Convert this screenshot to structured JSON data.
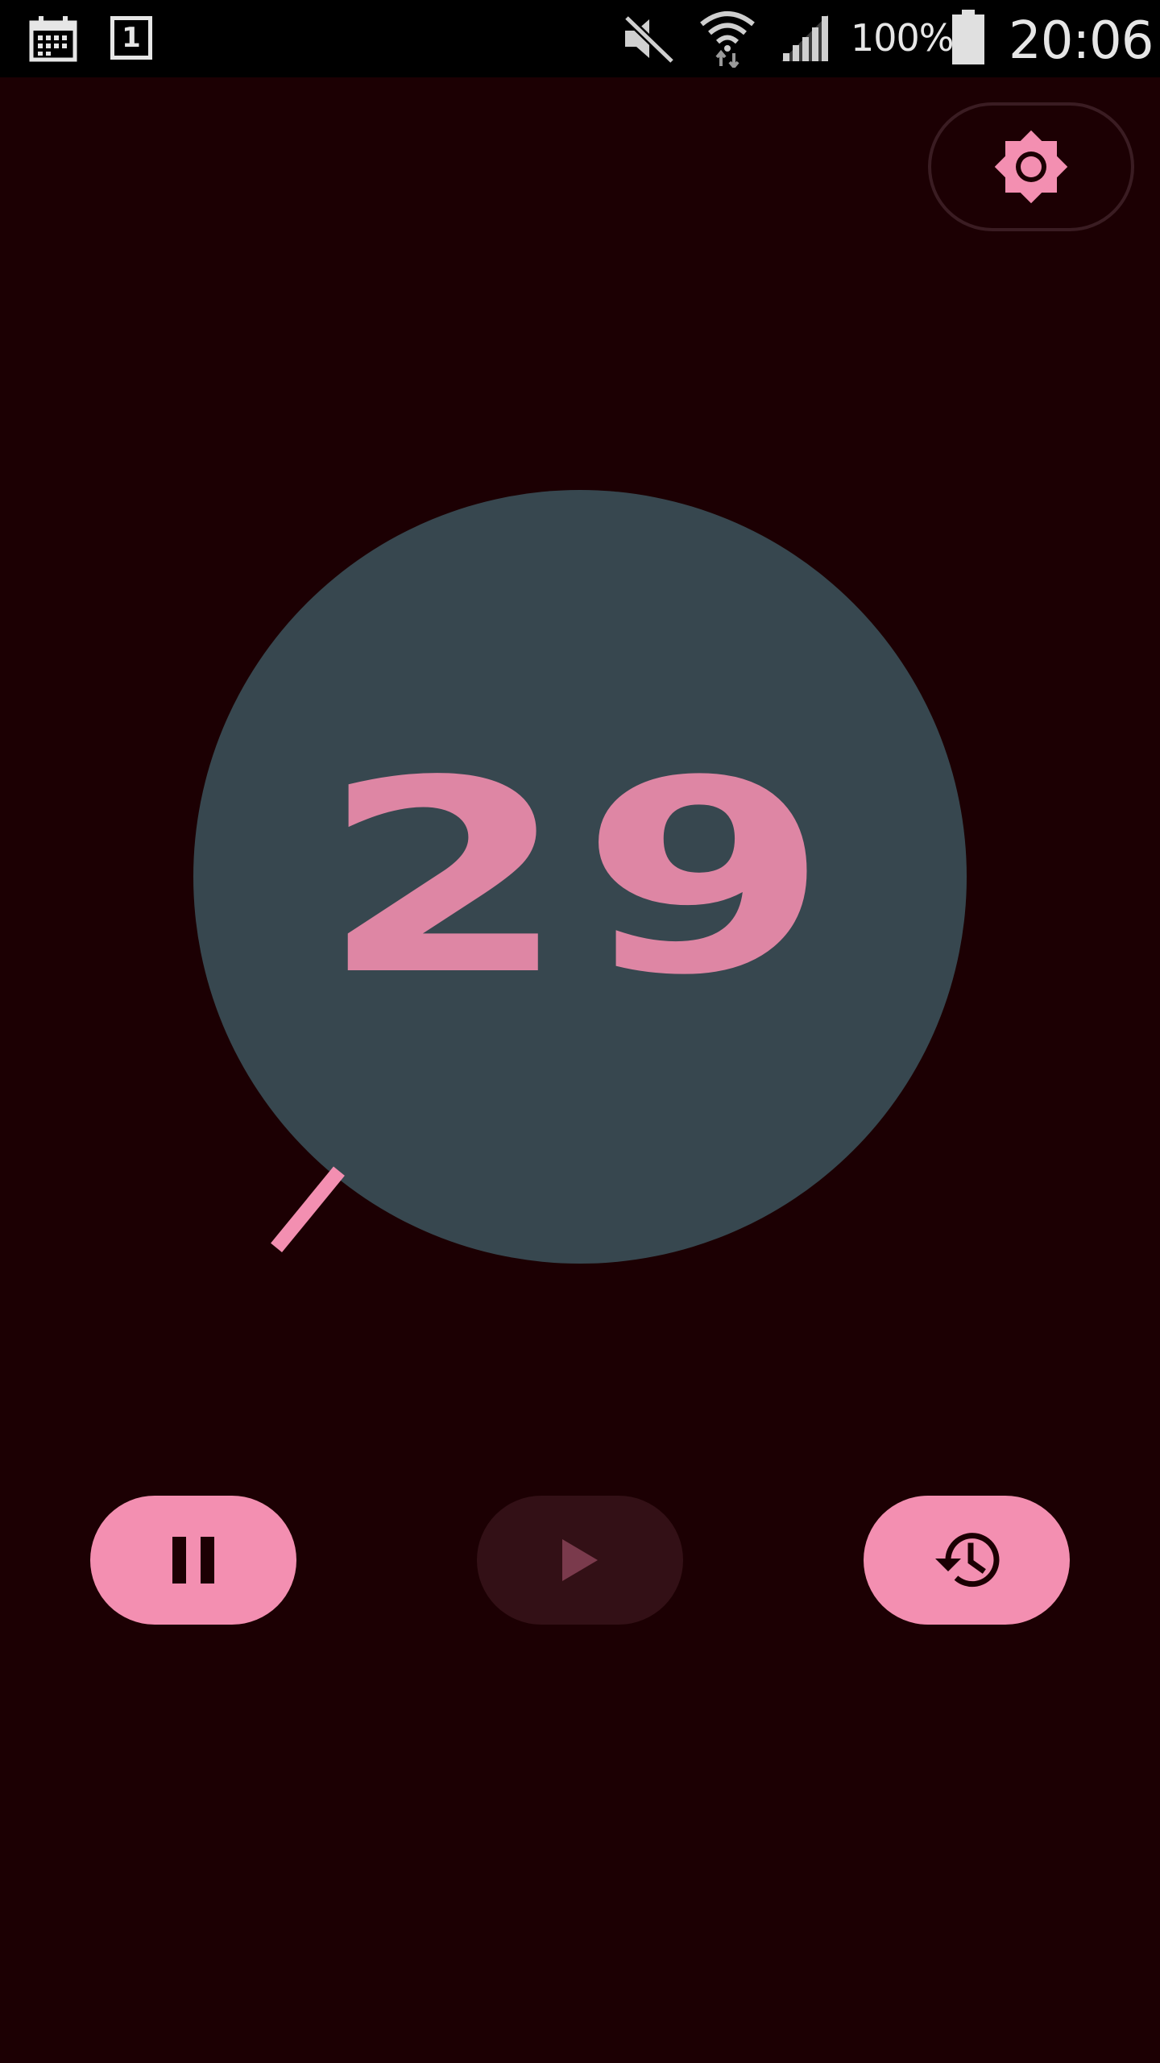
{
  "status_bar": {
    "battery_percent": "100%",
    "time": "20:06",
    "icons": [
      "calendar-icon",
      "calendar-day-icon",
      "mute-icon",
      "wifi-icon",
      "signal-icon",
      "battery-icon"
    ],
    "calendar_day": "1"
  },
  "settings": {
    "icon": "brightness-icon"
  },
  "timer": {
    "value": "29",
    "progress_fraction": 0.39
  },
  "controls": {
    "pause_icon": "pause-icon",
    "play_icon": "play-icon",
    "reset_icon": "restore-history-icon",
    "play_enabled": false
  },
  "colors": {
    "background": "#1c0003",
    "dial": "#37474f",
    "accent": "#f38fb1",
    "digits": "#de86a4",
    "disabled_button": "#331016",
    "disabled_icon": "#7a3a4c"
  }
}
